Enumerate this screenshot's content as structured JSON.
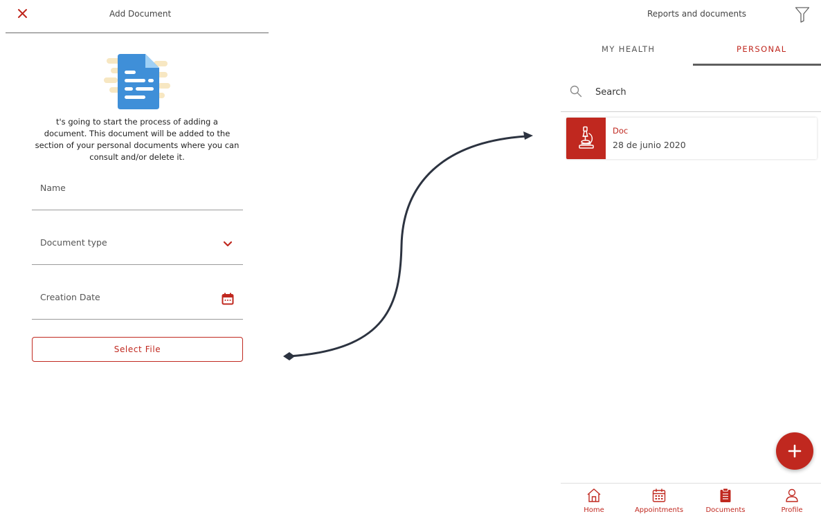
{
  "colors": {
    "accent": "#c0281f",
    "connector": "#2c3340",
    "document_icon": "#3f8fd8",
    "document_icon_fold": "#9fd0f5",
    "illustration_background": "#f7e7c2"
  },
  "add_document": {
    "close_icon": "close-icon",
    "title": "Add Document",
    "intro_text": "t's going to start the process of adding a document. This document will be added to the section of your personal documents where you can consult and/or delete it.",
    "fields": {
      "name_placeholder": "Name",
      "document_type_placeholder": "Document type",
      "document_type_icon": "chevron-down-icon",
      "creation_date_placeholder": "Creation Date",
      "creation_date_icon": "calendar-icon"
    },
    "select_file_label": "Select File"
  },
  "reports": {
    "title": "Reports and documents",
    "filter_icon": "filter-icon",
    "tabs": [
      {
        "label": "MY HEALTH",
        "active": false
      },
      {
        "label": "PERSONAL",
        "active": true
      }
    ],
    "search_icon": "search-icon",
    "search_placeholder": "Search",
    "documents": [
      {
        "title": "Doc",
        "date": "28 de junio 2020",
        "icon": "microscope-icon"
      }
    ],
    "fab_icon": "plus-icon",
    "nav": [
      {
        "label": "Home",
        "icon": "home-icon"
      },
      {
        "label": "Appointments",
        "icon": "calendar-icon"
      },
      {
        "label": "Documents",
        "icon": "clipboard-icon"
      },
      {
        "label": "Profile",
        "icon": "user-icon"
      }
    ]
  }
}
